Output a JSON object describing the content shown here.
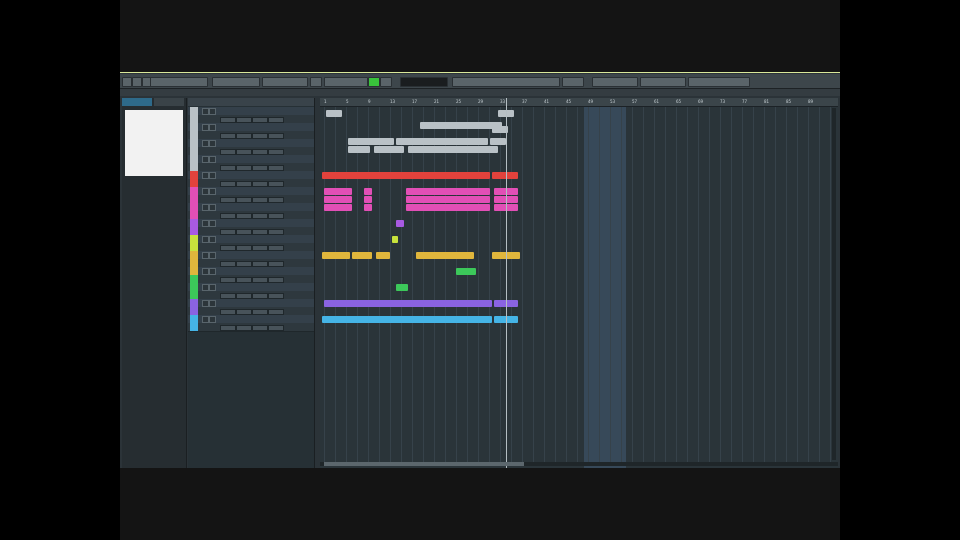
{
  "window": {
    "toolbar_buttons": [
      "",
      "",
      "",
      "",
      "",
      "",
      "",
      "",
      ""
    ],
    "transport_display": "",
    "menu_items": [
      "",
      "",
      "",
      "",
      "",
      "",
      "",
      "",
      ""
    ]
  },
  "inspector": {
    "tabs": [
      "",
      ""
    ],
    "list_item": ""
  },
  "ruler": {
    "bars": [
      "1",
      "5",
      "9",
      "13",
      "17",
      "21",
      "25",
      "29",
      "33",
      "37",
      "41",
      "45",
      "49",
      "53",
      "57",
      "61",
      "65",
      "69",
      "73",
      "77",
      "81",
      "85",
      "89"
    ]
  },
  "colors": {
    "silver": "#b9c1c6",
    "red": "#e2423c",
    "magenta": "#e24fb6",
    "violet": "#a85ae2",
    "lime": "#c8e23c",
    "yellow": "#e0b63c",
    "green": "#3cc85a",
    "purple": "#8a63e2",
    "cyan": "#45b4e6",
    "accent": "#39c23b"
  }
}
